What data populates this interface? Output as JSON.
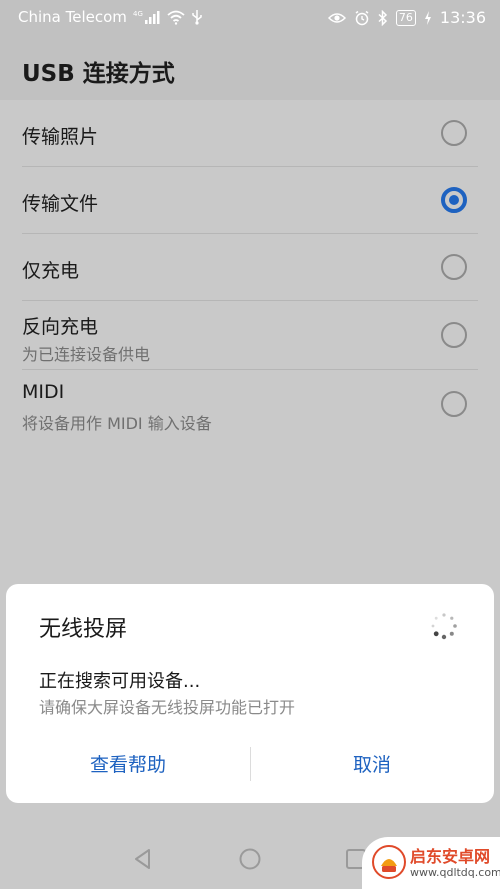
{
  "status_bar": {
    "carrier": "China Telecom",
    "network_type": "4G",
    "battery_level": "76",
    "time": "13:36",
    "icons": [
      "signal-icon",
      "wifi-icon",
      "usb-icon",
      "eye-icon",
      "alarm-icon",
      "bluetooth-icon",
      "battery-icon",
      "charging-icon"
    ]
  },
  "app_bar": {
    "title": "USB 连接方式"
  },
  "options": [
    {
      "label": "传输照片",
      "subtitle": "",
      "checked": false
    },
    {
      "label": "传输文件",
      "subtitle": "",
      "checked": true
    },
    {
      "label": "仅充电",
      "subtitle": "",
      "checked": false
    },
    {
      "label": "反向充电",
      "subtitle": "为已连接设备供电",
      "checked": false
    },
    {
      "label": "MIDI",
      "subtitle": "将设备用作 MIDI 输入设备",
      "checked": false
    }
  ],
  "dialog": {
    "title": "无线投屏",
    "message": "正在搜索可用设备...",
    "hint": "请确保大屏设备无线投屏功能已打开",
    "help_label": "查看帮助",
    "cancel_label": "取消"
  },
  "nav_bar": {
    "icons": [
      "back-icon",
      "home-icon",
      "recents-icon"
    ]
  },
  "watermark": {
    "brand": "启东安卓网",
    "url": "www.qdltdq.com"
  },
  "colors": {
    "accent": "#1e62c0",
    "scrim": "#c9c9c9"
  }
}
